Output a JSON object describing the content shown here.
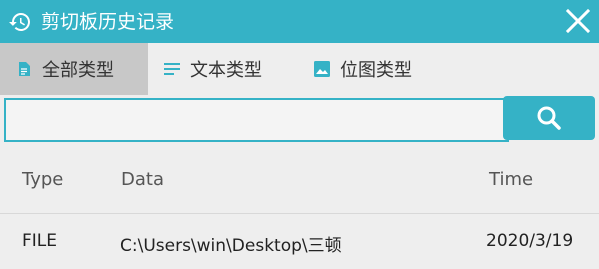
{
  "window": {
    "title": "剪切板历史记录",
    "colors": {
      "accent": "#35b2c6",
      "active_tab": "#c8c8c8",
      "background": "#eeeeee"
    }
  },
  "tabs": [
    {
      "label": "全部类型",
      "icon": "document-icon",
      "active": true
    },
    {
      "label": "文本类型",
      "icon": "text-lines-icon",
      "active": false
    },
    {
      "label": "位图类型",
      "icon": "image-icon",
      "active": false
    }
  ],
  "search": {
    "value": "",
    "placeholder": ""
  },
  "table": {
    "headers": [
      "Type",
      "Data",
      "Time"
    ],
    "rows": [
      [
        "FILE",
        "C:\\Users\\win\\Desktop\\三顿",
        "2020/3/19"
      ]
    ]
  }
}
